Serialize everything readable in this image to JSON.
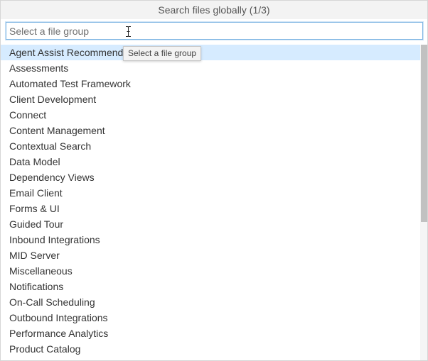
{
  "window": {
    "title": "Search files globally (1/3)"
  },
  "search": {
    "value": "",
    "placeholder": "Select a file group"
  },
  "tooltip": {
    "text": "Select a file group"
  },
  "list": {
    "items": [
      {
        "label": "Agent Assist Recommendations"
      },
      {
        "label": "Assessments"
      },
      {
        "label": "Automated Test Framework"
      },
      {
        "label": "Client Development"
      },
      {
        "label": "Connect"
      },
      {
        "label": "Content Management"
      },
      {
        "label": "Contextual Search"
      },
      {
        "label": "Data Model"
      },
      {
        "label": "Dependency Views"
      },
      {
        "label": "Email Client"
      },
      {
        "label": "Forms & UI"
      },
      {
        "label": "Guided Tour"
      },
      {
        "label": "Inbound Integrations"
      },
      {
        "label": "MID Server"
      },
      {
        "label": "Miscellaneous"
      },
      {
        "label": "Notifications"
      },
      {
        "label": "On-Call Scheduling"
      },
      {
        "label": "Outbound Integrations"
      },
      {
        "label": "Performance Analytics"
      },
      {
        "label": "Product Catalog"
      }
    ]
  },
  "colors": {
    "selected_row": "#d6ebff",
    "input_focus_border": "#7fb6e3",
    "scroll_thumb": "#c1c1c1"
  },
  "icons": {
    "cursor": "text-cursor-icon"
  }
}
